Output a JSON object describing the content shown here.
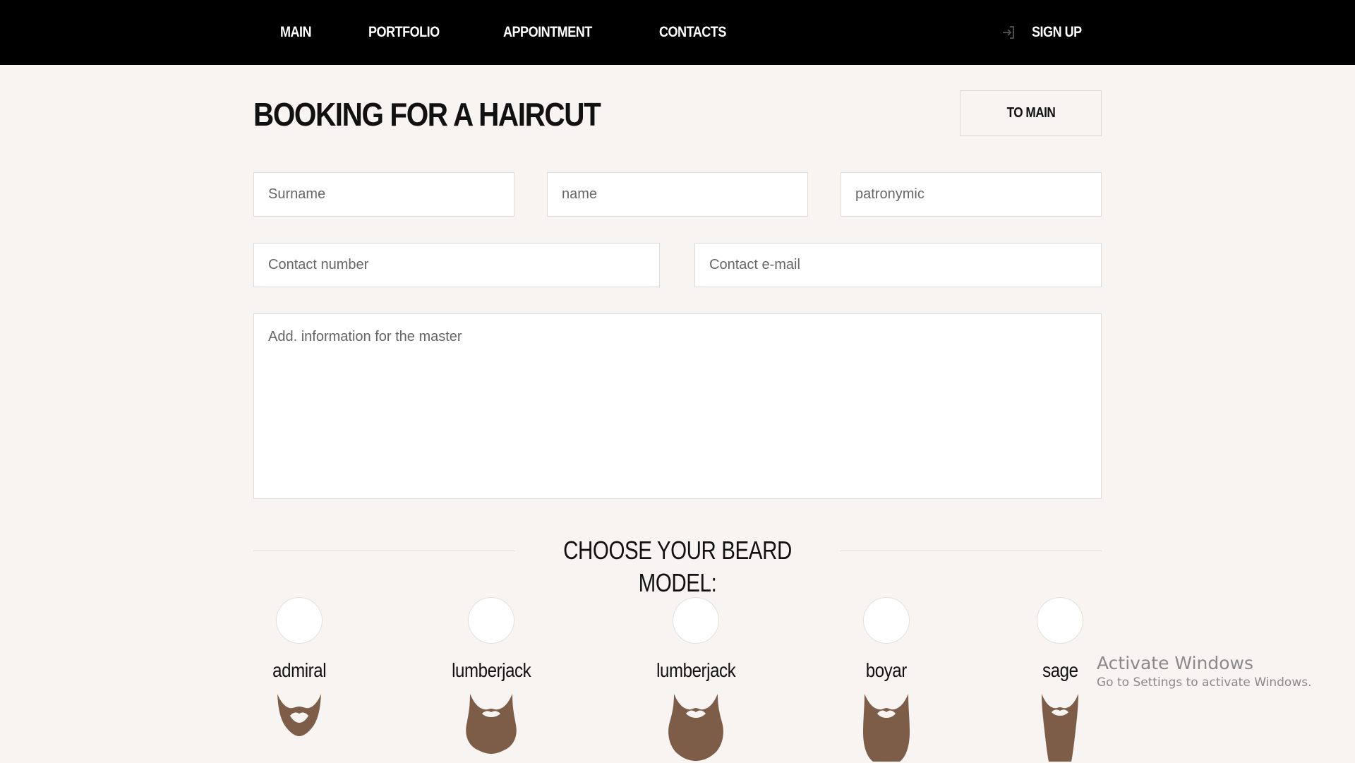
{
  "nav": {
    "items": [
      {
        "label": "MAIN"
      },
      {
        "label": "PORTFOLIO"
      },
      {
        "label": "APPOINTMENT"
      },
      {
        "label": "CONTACTS"
      }
    ],
    "signup_label": "SIGN UP",
    "signup_icon": "sign-in-icon"
  },
  "page": {
    "title": "BOOKING FOR A HAIRCUT",
    "to_main_label": "TO MAIN"
  },
  "form": {
    "surname_placeholder": "Surname",
    "name_placeholder": "name",
    "patronymic_placeholder": "patronymic",
    "phone_placeholder": "Contact number",
    "email_placeholder": "Contact e-mail",
    "info_placeholder": "Add. information for the master"
  },
  "beards": {
    "heading": "CHOOSE YOUR BEARD MODEL:",
    "color": "#7d5d48",
    "models": [
      {
        "label": "admiral",
        "icon": "admiral-beard-icon"
      },
      {
        "label": "lumberjack",
        "icon": "lumberjack-beard-icon"
      },
      {
        "label": "lumberjack",
        "icon": "full-beard-icon"
      },
      {
        "label": "boyar",
        "icon": "boyar-beard-icon"
      },
      {
        "label": "sage",
        "icon": "sage-beard-icon"
      }
    ]
  },
  "watermark": {
    "title": "Activate Windows",
    "subtitle": "Go to Settings to activate Windows."
  }
}
